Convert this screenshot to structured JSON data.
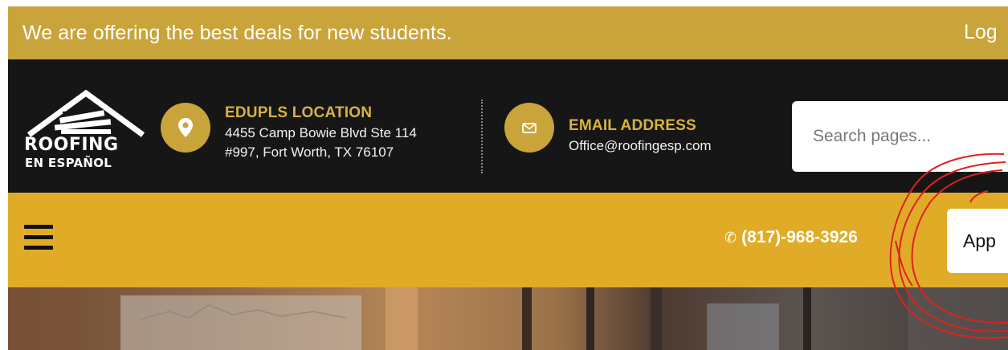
{
  "topbar": {
    "message": "We are offering the best deals for new students.",
    "login_label": "Log"
  },
  "brand": {
    "logo_line1": "ROOFING",
    "logo_line2": "EN ESPAÑOL",
    "primary_color": "#c9a43a",
    "nav_color": "#e0ac28",
    "header_color": "#161616"
  },
  "location": {
    "icon": "map-pin-icon",
    "title": "EDUPLS LOCATION",
    "line1": "4455 Camp Bowie Blvd Ste 114",
    "line2": "#997, Fort Worth, TX 76107"
  },
  "email": {
    "icon": "envelope-icon",
    "title": "EMAIL ADDRESS",
    "address": "Office@roofingesp.com"
  },
  "search": {
    "placeholder": "Search pages..."
  },
  "nav": {
    "phone": "(817)-968-3926",
    "apply_label": "App"
  }
}
